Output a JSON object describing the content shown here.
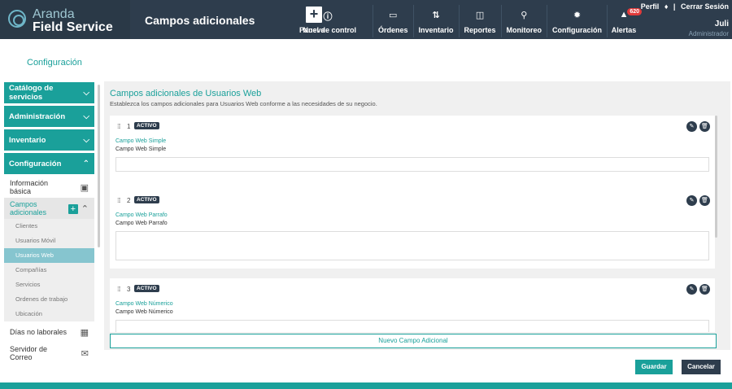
{
  "brand": {
    "line1": "Aranda",
    "line2": "Field Service"
  },
  "header": {
    "module_title": "Campos adicionales"
  },
  "nav": [
    {
      "label": "Nueva",
      "icon": "plus-icon"
    },
    {
      "label": "Panel de control",
      "icon": "info-icon"
    },
    {
      "label": "Órdenes",
      "icon": "orders-icon"
    },
    {
      "label": "Inventario",
      "icon": "inventory-icon"
    },
    {
      "label": "Reportes",
      "icon": "reports-icon"
    },
    {
      "label": "Monitoreo",
      "icon": "monitor-icon"
    },
    {
      "label": "Configuración",
      "icon": "gear-icon"
    },
    {
      "label": "Alertas",
      "icon": "bell-icon",
      "badge": "620"
    }
  ],
  "profile": {
    "perfil": "Perfil",
    "logout": "Cerrar Sesión",
    "user": "Juli",
    "role": "Administrador"
  },
  "breadcrumb": "Configuración",
  "sidebar": {
    "catalogo": "Catálogo de servicios",
    "administracion": "Administración",
    "inventario": "Inventario",
    "configuracion": "Configuración",
    "info_basica": "Información básica",
    "campos_adicionales": "Campos adicionales",
    "children": [
      "Clientes",
      "Usuarios Móvil",
      "Usuarios Web",
      "Compañías",
      "Servicios",
      "Ordenes de trabajo",
      "Ubicación"
    ],
    "dias": "Días no laborales",
    "servidor": "Servidor de Correo"
  },
  "main": {
    "title": "Campos adicionales de Usuarios Web",
    "subtitle": "Establezca los campos adicionales para Usuarios Web conforme a las necesidades de su negocio.",
    "cards": [
      {
        "num": "1",
        "status": "ACTIVO",
        "label": "Campo Web Simple",
        "desc": "Campo Web Simple"
      },
      {
        "num": "2",
        "status": "ACTIVO",
        "label": "Campo Web Parrafo",
        "desc": "Campo Web Parrafo"
      },
      {
        "num": "3",
        "status": "ACTIVO",
        "label": "Campo Web Númerico",
        "desc": "Campo Web Númerico"
      }
    ],
    "new_field": "Nuevo Campo Adicional"
  },
  "buttons": {
    "save": "Guardar",
    "cancel": "Cancelar"
  }
}
